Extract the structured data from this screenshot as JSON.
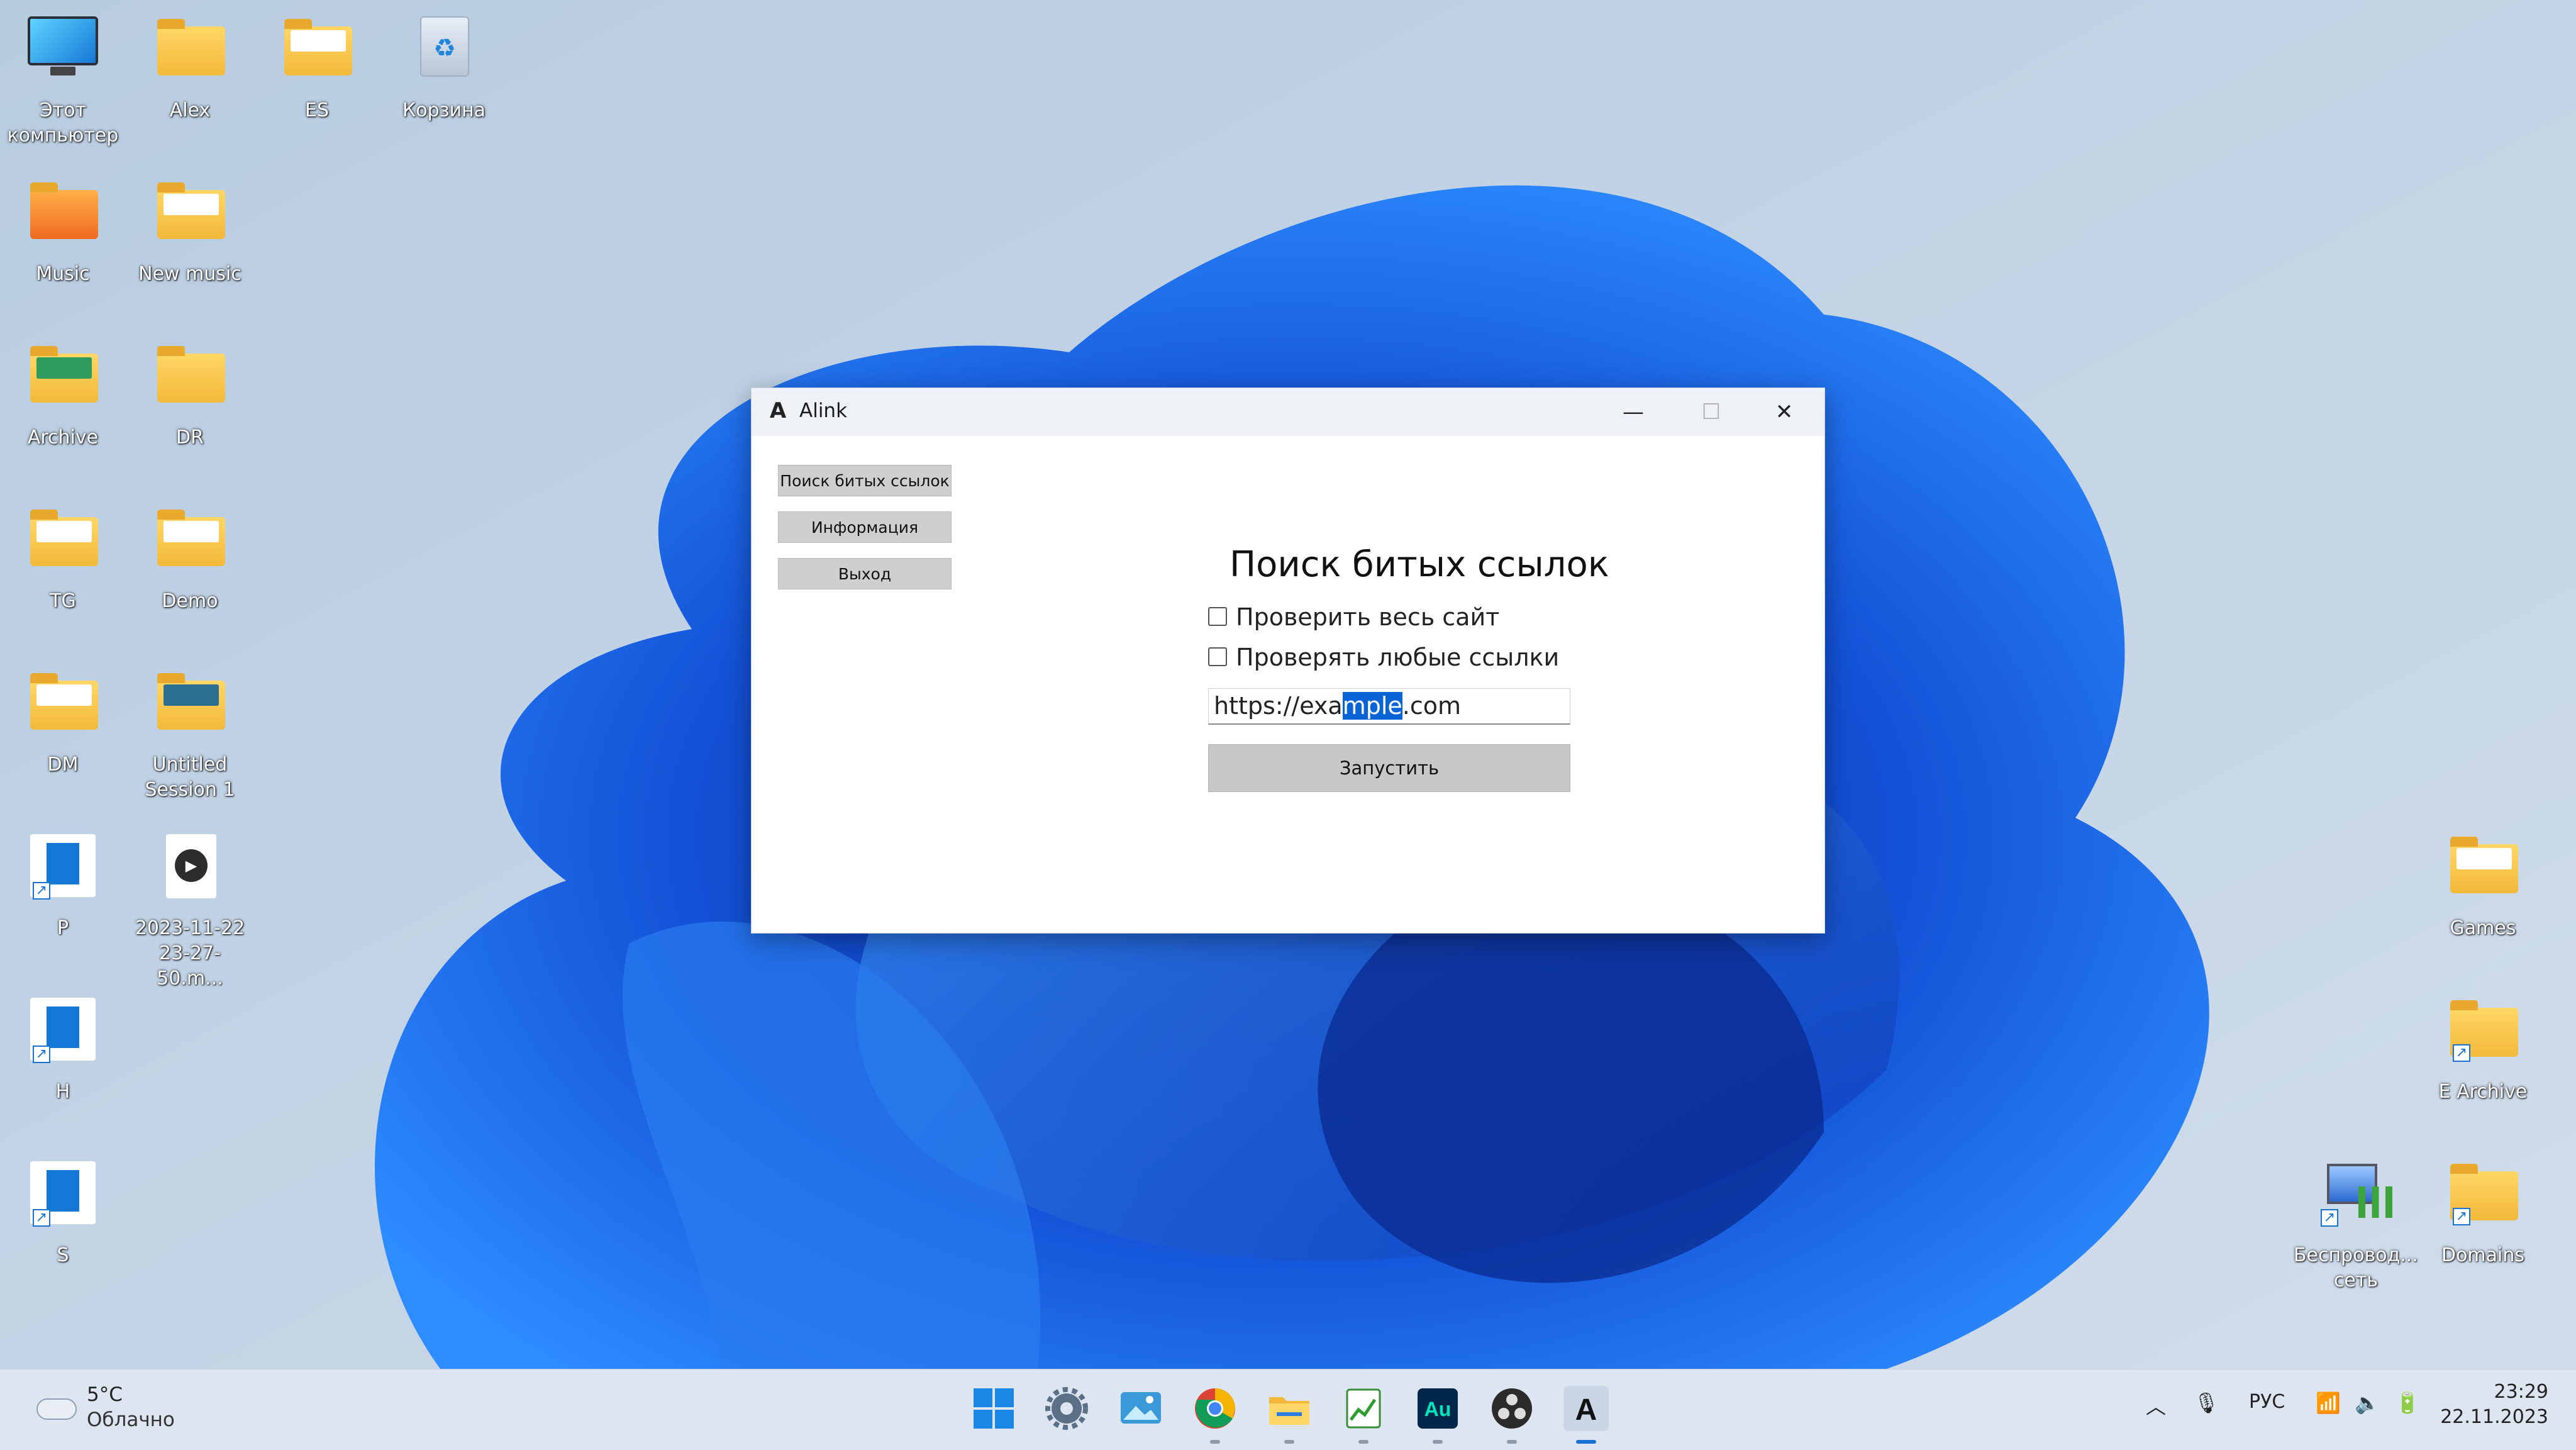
{
  "desktop": {
    "icons_left": [
      {
        "label": "Этот\nкомпьютер",
        "icon": "this-pc-icon"
      },
      {
        "label": "Alex",
        "icon": "user-folder-icon"
      },
      {
        "label": "ES",
        "icon": "folder-icon"
      },
      {
        "label": "Корзина",
        "icon": "recycle-bin-icon"
      },
      {
        "label": "Music",
        "icon": "folder-icon"
      },
      {
        "label": "New music",
        "icon": "folder-icon"
      },
      {
        "label": "Archive",
        "icon": "folder-icon"
      },
      {
        "label": "DR",
        "icon": "folder-icon"
      },
      {
        "label": "TG",
        "icon": "folder-icon"
      },
      {
        "label": "Demo",
        "icon": "folder-icon"
      },
      {
        "label": "DM",
        "icon": "folder-icon"
      },
      {
        "label": "Untitled\nSession 1",
        "icon": "folder-icon"
      },
      {
        "label": "P",
        "icon": "shortcut-icon"
      },
      {
        "label": "2023-11-22\n23-27-50.m...",
        "icon": "media-file-icon"
      },
      {
        "label": "H",
        "icon": "shortcut-icon"
      },
      {
        "label": "S",
        "icon": "shortcut-icon"
      }
    ],
    "icons_right": [
      {
        "label": "Games",
        "icon": "folder-icon"
      },
      {
        "label": "E Archive",
        "icon": "folder-shortcut-icon"
      },
      {
        "label": "Беспровод...\nсеть",
        "icon": "network-icon"
      },
      {
        "label": "Domains",
        "icon": "folder-shortcut-icon"
      }
    ]
  },
  "window": {
    "title": "Alink",
    "logo_char": "A",
    "controls": {
      "minimize": "—",
      "maximize": "☐",
      "close": "✕"
    },
    "sidebar": [
      {
        "label": "Поиск битых ссылок"
      },
      {
        "label": "Информация"
      },
      {
        "label": "Выход"
      }
    ],
    "main": {
      "title": "Поиск битых ссылок",
      "checkboxes": [
        {
          "label": "Проверить весь сайт",
          "checked": false
        },
        {
          "label": "Проверять любые ссылки",
          "checked": false
        }
      ],
      "url": {
        "before": "https://exa",
        "selected": "mple",
        "after": ".com"
      },
      "run_label": "Запустить"
    }
  },
  "taskbar": {
    "weather": {
      "temp": "5°C",
      "desc": "Облачно"
    },
    "apps": [
      "start-icon",
      "settings-icon",
      "photos-icon",
      "chrome-icon",
      "file-explorer-icon",
      "sheets-icon",
      "audition-icon",
      "obs-icon",
      "alink-icon"
    ],
    "tray": {
      "language": "РУС",
      "time": "23:29",
      "date": "22.11.2023"
    }
  }
}
